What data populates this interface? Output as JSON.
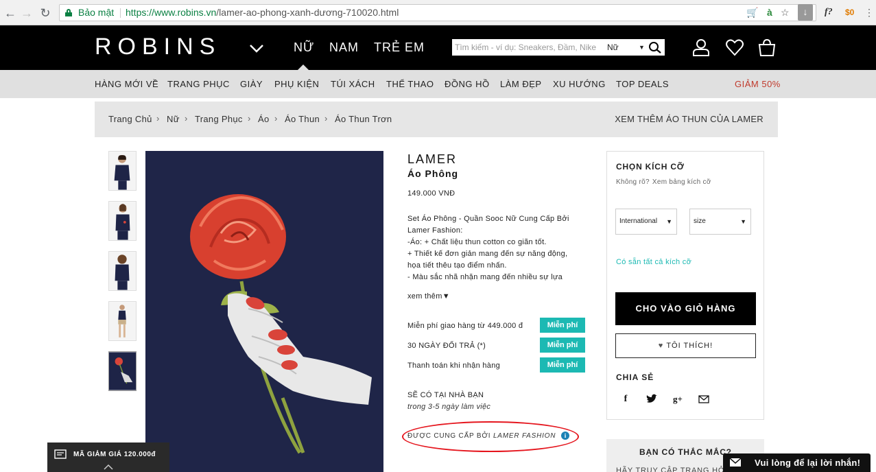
{
  "browser": {
    "secure_label": "Bảo mật",
    "url_scheme_host": "https://www.robins.vn",
    "url_path": "/lamer-ao-phong-xanh-dương-710020.html"
  },
  "header": {
    "logo": "ROBINS",
    "nav": [
      "NỮ",
      "NAM",
      "TRẺ EM"
    ],
    "search_placeholder": "Tìm kiếm - ví dụ: Sneakers, Đầm, Nike",
    "search_gender": "Nữ"
  },
  "categories": [
    "HÀNG MỚI VỀ",
    "TRANG PHỤC",
    "GIÀY",
    "PHỤ KIỆN",
    "TÚI XÁCH",
    "THỂ THAO",
    "ĐỒNG HỒ",
    "LÀM ĐẸP",
    "XU HƯỚNG",
    "TOP DEALS"
  ],
  "sale_category": "GIẢM 50%",
  "breadcrumb": {
    "items": [
      "Trang Chủ",
      "Nữ",
      "Trang Phục",
      "Áo",
      "Áo Thun",
      "Áo Thun Trơn"
    ],
    "more": "XEM THÊM ÁO THUN CỦA LAMER"
  },
  "product": {
    "brand": "LAMER",
    "name": "Áo Phông",
    "price": "149.000 VNĐ",
    "description": [
      "Set Áo Phông - Quần Sooc Nữ Cung Cấp Bởi",
      "Lamer Fashion:",
      "-Áo: + Chất liệu thun cotton co giãn tốt.",
      "+ Thiết kế đơn giản mang đến sự năng động,",
      "họa tiết thêu tạo điểm nhấn.",
      "- Màu sắc nhã nhặn mang đến nhiều sự lựa"
    ],
    "see_more": "xem thêm▼",
    "perks": [
      {
        "label": "Miễn phí giao hàng từ 449.000 đ",
        "badge": "Miễn phí"
      },
      {
        "label": "30 NGÀY ĐỔI TRẢ (*)",
        "badge": "Miễn phí"
      },
      {
        "label": "Thanh toán khi nhận hàng",
        "badge": "Miễn phí"
      }
    ],
    "delivery_title": "SẼ CÓ TẠI NHÀ BẠN",
    "delivery_sub": "trong 3-5 ngày làm việc",
    "supplier_prefix": "ĐƯỢC CUNG CẤP BỞI",
    "supplier_name": "LAMER FASHION"
  },
  "size_panel": {
    "title": "CHỌN KÍCH CỠ",
    "help_q": "Không rõ?",
    "help_link": "Xem bảng kích cỡ",
    "system_select": "International",
    "size_select": "size",
    "available": "Có sẵn tất cả kích cỡ",
    "add_to_cart": "CHO VÀO GIỎ HÀNG",
    "like": "TÔI THÍCH!",
    "share_title": "CHIA SẺ",
    "share_icons": [
      "facebook-icon",
      "twitter-icon",
      "google-plus-icon",
      "email-icon"
    ]
  },
  "faq": {
    "title": "BẠN CÓ THẮC MẮC?",
    "sub": "HÃY TRUY CẬP TRANG HỎI"
  },
  "coupon": {
    "text": "MÃ GIẢM GIÁ 120.000đ"
  },
  "chat": {
    "text": "Vui lòng để lại lời nhắn!"
  },
  "colors": {
    "accent_teal": "#1cb9b3",
    "sale_red": "#c0392b",
    "highlight_circle": "#e5151d",
    "header_bg": "#000000"
  }
}
